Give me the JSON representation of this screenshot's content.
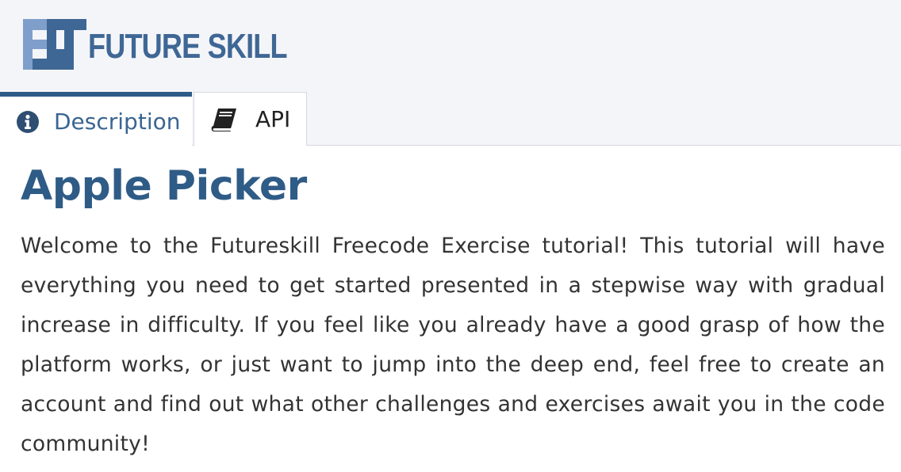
{
  "brand": {
    "name": "FUTURE SKILL",
    "colors": {
      "primary": "#2e5c88",
      "logo_light": "#7f9fca",
      "logo_dark": "#3f6795"
    }
  },
  "tabs": [
    {
      "label": "Description",
      "icon": "info-circle-icon",
      "active": true
    },
    {
      "label": "API",
      "icon": "book-icon",
      "active": false
    }
  ],
  "main": {
    "title": "Apple Picker",
    "description": "Welcome to the Futureskill Freecode Exercise tutorial! This tutorial will have everything you need to get started presented in a stepwise way with gradual increase in difficulty. If you feel like you already have a good grasp of how the platform works, or just want to jump into the deep end, feel free to create an account and find out what other challenges and exercises await you in the code community!"
  }
}
